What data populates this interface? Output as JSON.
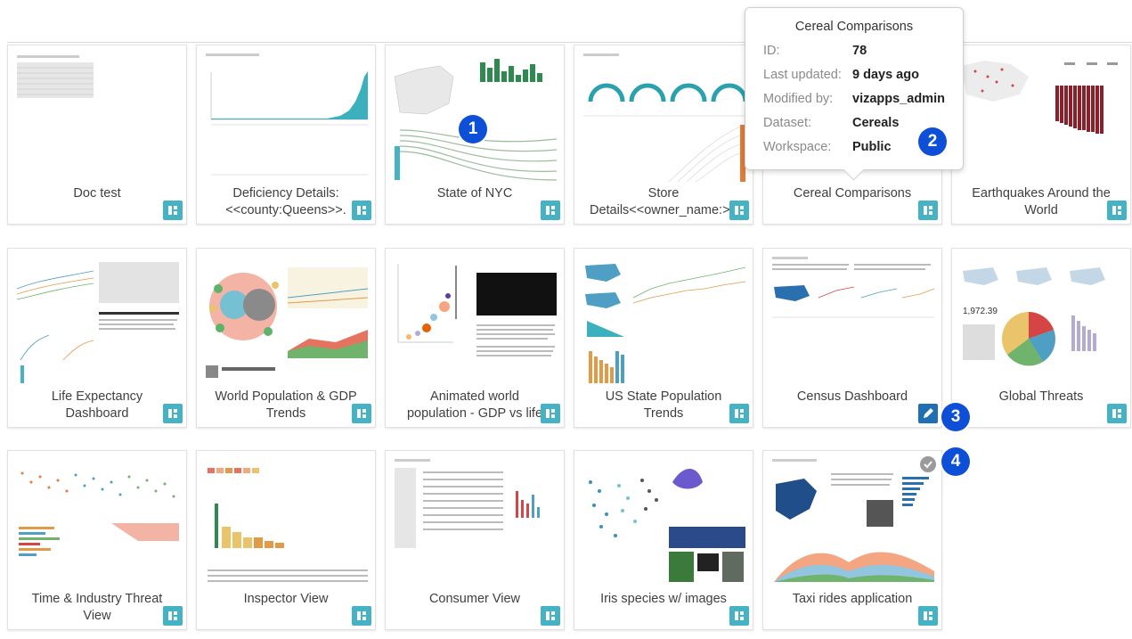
{
  "cards": [
    {
      "title": "Doc test",
      "action": "dashboard"
    },
    {
      "title": "Deficiency Details:\n<<county:Queens>>.",
      "action": "dashboard"
    },
    {
      "title": "State of NYC",
      "action": "dashboard"
    },
    {
      "title": "Store\nDetails<<owner_name:>>",
      "action": "dashboard"
    },
    {
      "title": "Cereal Comparisons",
      "action": "dashboard"
    },
    {
      "title": "Earthquakes Around the\nWorld",
      "action": "dashboard"
    },
    {
      "title": "Life Expectancy\nDashboard",
      "action": "dashboard"
    },
    {
      "title": "World Population & GDP\nTrends",
      "action": "dashboard"
    },
    {
      "title": "Animated world\npopulation - GDP vs life",
      "action": "dashboard"
    },
    {
      "title": "US State Population\nTrends",
      "action": "dashboard"
    },
    {
      "title": "Census Dashboard",
      "action": "edit"
    },
    {
      "title": "Global Threats",
      "action": "dashboard"
    },
    {
      "title": "Time & Industry Threat\nView",
      "action": "dashboard"
    },
    {
      "title": "Inspector View",
      "action": "dashboard"
    },
    {
      "title": "Consumer View",
      "action": "dashboard"
    },
    {
      "title": "Iris species w/ images",
      "action": "dashboard"
    },
    {
      "title": "Taxi rides application",
      "action": "dashboard"
    }
  ],
  "tooltip": {
    "title": "Cereal Comparisons",
    "rows": [
      {
        "label": "ID:",
        "value": "78"
      },
      {
        "label": "Last updated:",
        "value": "9 days ago"
      },
      {
        "label": "Modified by:",
        "value": "vizapps_admin"
      },
      {
        "label": "Dataset:",
        "value": "Cereals"
      },
      {
        "label": "Workspace:",
        "value": "Public"
      }
    ]
  },
  "badges": [
    "1",
    "2",
    "3",
    "4"
  ],
  "colors": {
    "dashboard_button": "#45b3c4",
    "edit_button": "#1f6fb2",
    "badge": "#0d4fd6"
  },
  "icons": {
    "dashboard": "dashboard-layout-icon",
    "edit": "pencil-icon",
    "selected": "checkmark-icon"
  }
}
